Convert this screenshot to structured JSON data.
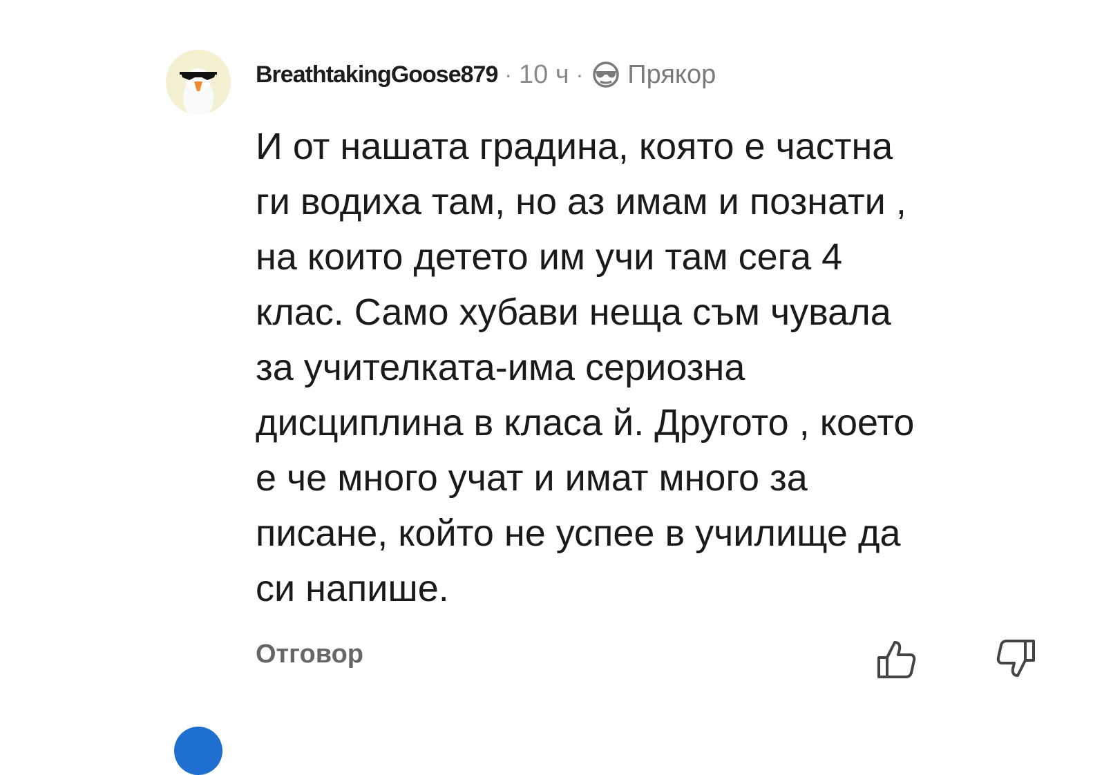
{
  "comment": {
    "username": "BreathtakingGoose879",
    "separator": "·",
    "time": "10 ч",
    "flair": "Прякор",
    "body_lines": [
      "И от нашата градина, която е частна",
      "ги водиха там, но аз имам и познати ,",
      "на които детето им учи там сега 4",
      "клас. Само хубави неща съм чувала",
      "за учителката-има сериозна",
      "дисциплина в класа й. Другото , което",
      "е че много учат и имат много за",
      "писане, който не успее в училище да",
      "си напише."
    ],
    "reply_label": "Отговор",
    "icons": {
      "avatar": "goose-sunglasses-avatar",
      "flair": "sunglasses-icon",
      "upvote": "thumbs-up-icon",
      "downvote": "thumbs-down-icon"
    }
  }
}
